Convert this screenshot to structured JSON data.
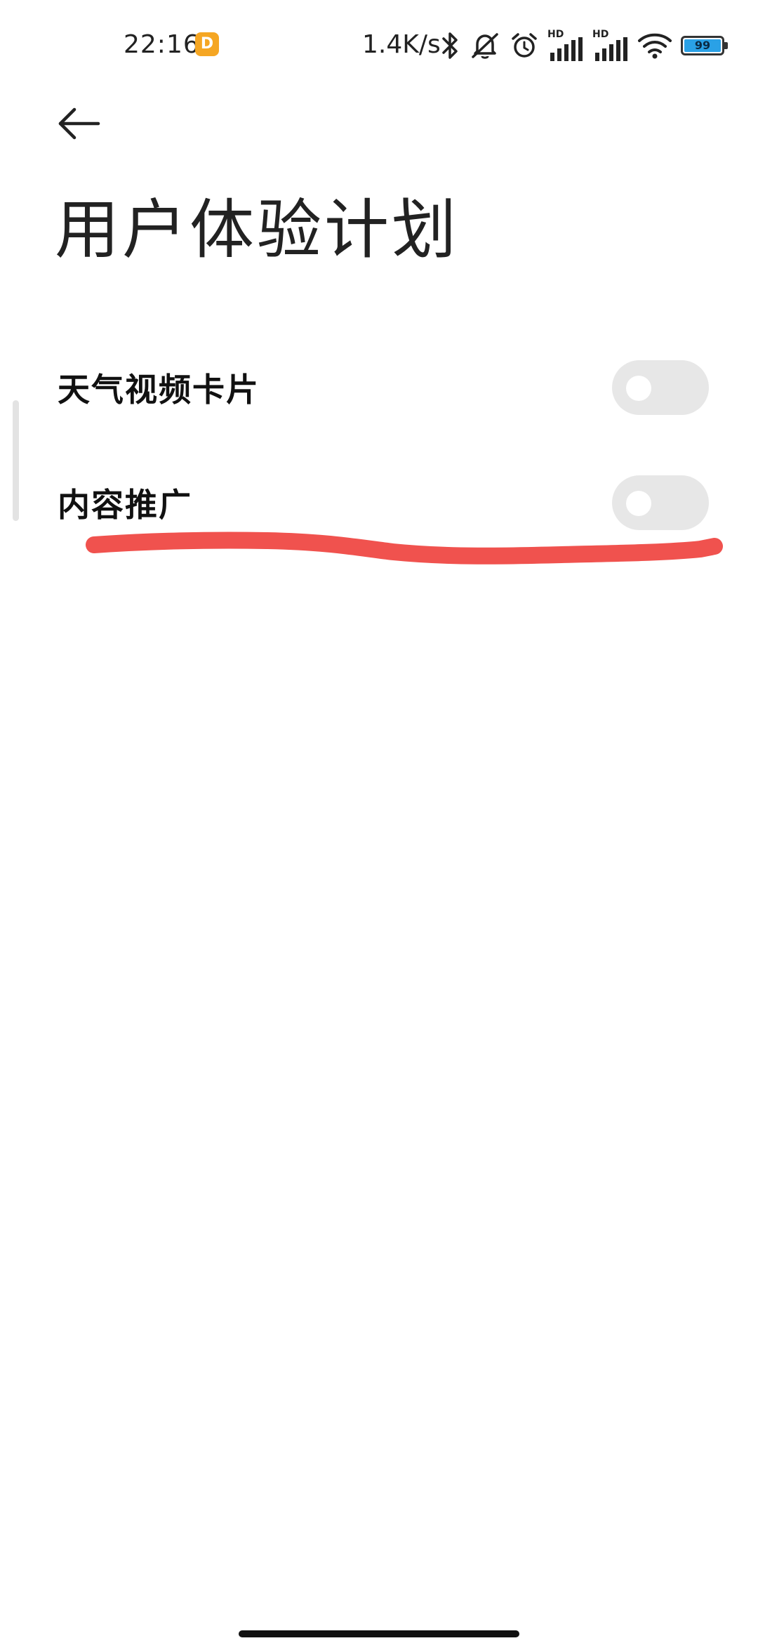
{
  "status_bar": {
    "time": "22:16",
    "app_badge": "D",
    "net_speed": "1.4K/s",
    "hd_label_1": "HD",
    "hd_label_2": "HD",
    "battery_level": "99",
    "battery_color": "#2aa1e6",
    "icons": [
      "bluetooth-icon",
      "mute-icon",
      "alarm-icon",
      "signal-icon",
      "signal-icon",
      "wifi-icon",
      "battery-icon"
    ]
  },
  "header": {
    "back_icon": "arrow-left-icon",
    "title": "用户体验计划"
  },
  "settings": [
    {
      "label": "天气视频卡片",
      "enabled": false
    },
    {
      "label": "内容推广",
      "enabled": false
    }
  ],
  "annotation_color": "#f0524e"
}
